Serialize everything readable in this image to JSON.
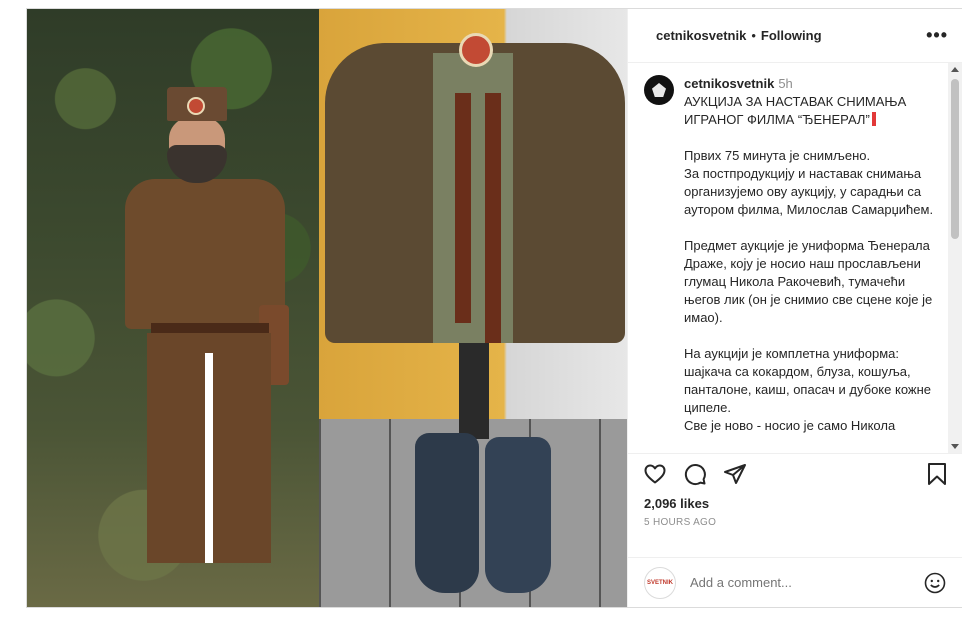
{
  "post": {
    "username": "cetnikosvetnik",
    "separator": "•",
    "follow_state": "Following",
    "more_label": "•••"
  },
  "caption": {
    "username": "cetnikosvetnik",
    "time": "5h",
    "title": "АУКЦИЈА ЗА НАСТАВАК СНИМАЊА ИГРАНОГ ФИЛМА “ЂЕНЕРАЛ”",
    "p1": "Првих 75 минута је снимљено.\nЗа постпродукцију и наставак снимања организујемо ову аукцију, у сарадњи са аутором филма, Милослав Самарџићем.",
    "p2": "Предмет аукције је униформа Ђенерала Драже, коју је носио наш прослављени глумац Никола Ракочевић, тумачећи његов лик (он је снимио све сцене које је имао).",
    "p3": "На аукцији је комплетна униформа: шајкача са кокардом, блуза, кошуља, панталоне, каиш, опасач и дубоке кожне ципеле.\nСве је ново - носио је само Никола"
  },
  "actions": {
    "icons": [
      "heart-icon",
      "comment-icon",
      "share-icon",
      "bookmark-icon"
    ],
    "likes": "2,096 likes",
    "time_ago": "5 HOURS AGO"
  },
  "comment_box": {
    "placeholder": "Add a comment...",
    "avatar_text": "SVETNIK"
  }
}
